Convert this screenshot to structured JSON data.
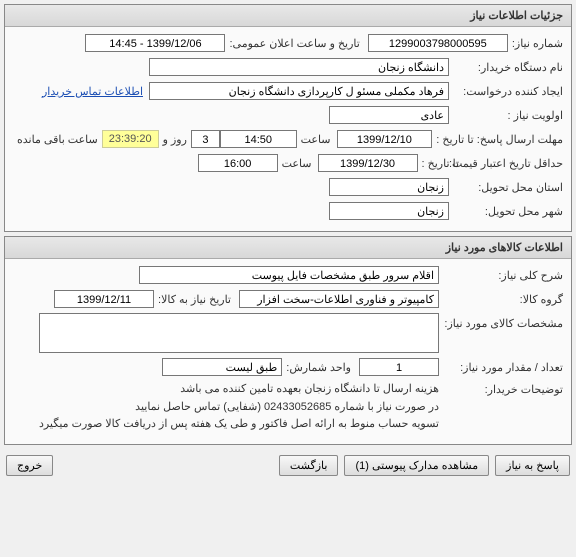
{
  "panel1": {
    "title": "جزئیات اطلاعات نیاز",
    "need_no_label": "شماره نیاز:",
    "need_no": "1299003798000595",
    "announce_label": "تاریخ و ساعت اعلان عمومی:",
    "announce_val": "1399/12/06 - 14:45",
    "buyer_org_label": "نام دستگاه خریدار:",
    "buyer_org": "دانشگاه زنجان",
    "requester_label": "ایجاد کننده درخواست:",
    "requester": "فرهاد مکملی مسئو ل کارپردازی دانشگاه زنجان",
    "contact_link": "اطلاعات تماس خریدار",
    "priority_label": "اولویت نیاز :",
    "priority": "عادی",
    "deadline_label": "مهلت ارسال پاسخ:  تا تاریخ :",
    "deadline_date": "1399/12/10",
    "deadline_time_label": "ساعت",
    "deadline_time": "14:50",
    "days_val": "3",
    "days_label": "روز و",
    "countdown": "23:39:20",
    "remain_label": "ساعت باقی مانده",
    "min_valid_label": "حداقل تاریخ اعتبار قیمت:",
    "min_valid_sub": "تا تاریخ :",
    "min_valid_date": "1399/12/30",
    "min_valid_time": "16:00",
    "state_label": "استان محل تحویل:",
    "state": "زنجان",
    "city_label": "شهر محل تحویل:",
    "city": "زنجان"
  },
  "panel2": {
    "title": "اطلاعات کالاهای مورد نیاز",
    "desc_label": "شرح کلی نیاز:",
    "desc": "اقلام سرور طبق مشخصات فایل پیوست",
    "group_label": "گروه کالا:",
    "group": "کامپیوتر و فناوری اطلاعات-سخت افزار",
    "need_to_label": "تاریخ نیاز به کالا:",
    "need_to": "1399/12/11",
    "spec_label": "مشخصات کالای مورد نیاز:",
    "qty_label": "تعداد / مقدار مورد نیاز:",
    "qty": "1",
    "unit_label": "واحد شمارش:",
    "unit": "طبق لیست",
    "notes_label": "توضیحات خریدار:",
    "notes": "هزینه ارسال تا دانشگاه زنجان بعهده تامین کننده می باشد\nدر صورت نیاز با شماره 02433052685 (شفایی) تماس حاصل نمایید\nتسویه حساب منوط به ارائه اصل فاکتور و طی یک هفته پس از دریافت کالا صورت میگیرد"
  },
  "buttons": {
    "reply": "پاسخ به نیاز",
    "attach": "مشاهده مدارک پیوستی (1)",
    "back": "بازگشت",
    "exit": "خروج"
  }
}
